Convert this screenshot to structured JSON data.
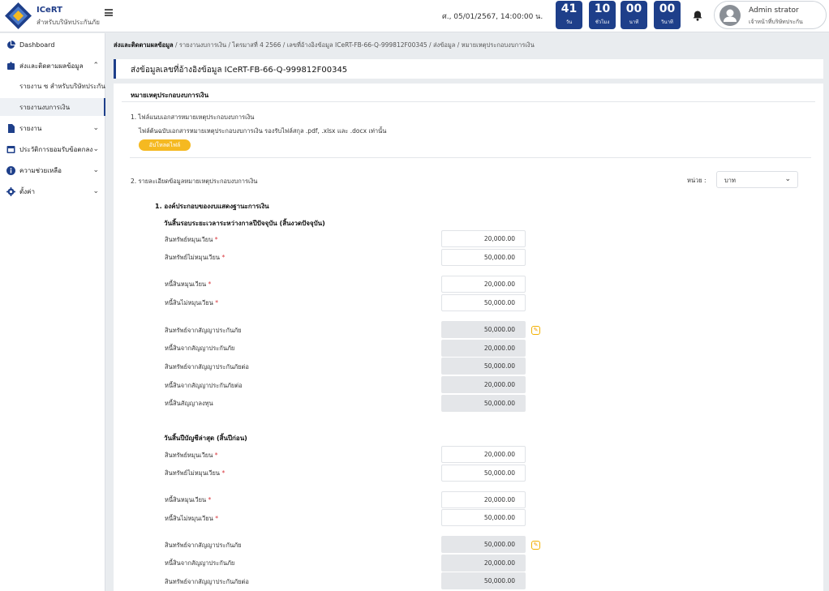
{
  "header": {
    "brand_name": "ICeRT",
    "brand_sub": "สำหรับบริษัทประกันภัย",
    "datetime": "ศ., 05/01/2567, 14:00:00 น.",
    "countdown": [
      {
        "value": "41",
        "label": "วัน"
      },
      {
        "value": "10",
        "label": "ชั่วโมง"
      },
      {
        "value": "00",
        "label": "นาที"
      },
      {
        "value": "00",
        "label": "วินาที"
      }
    ],
    "user_name": "Admin strator",
    "user_role": "เจ้าหน้าที่บริษัทประกัน"
  },
  "sidebar": {
    "items": [
      {
        "label": "Dashboard",
        "chevron": ""
      },
      {
        "label": "ส่งและติดตามผลข้อมูล",
        "chevron": "⌃"
      },
      {
        "label": "รายงาน",
        "chevron": "⌄"
      },
      {
        "label": "ประวัติการยอมรับข้อตกลง",
        "chevron": "⌄"
      },
      {
        "label": "ความช่วยเหลือ",
        "chevron": "⌄"
      },
      {
        "label": "ตั้งค่า",
        "chevron": "⌄"
      }
    ],
    "sub_items": [
      {
        "label": "รายงาน ซ สำหรับบริษัทประกัน"
      },
      {
        "label": "รายงานงบการเงิน"
      }
    ]
  },
  "breadcrumb": {
    "root": "ส่งและติดตามผลข้อมูล",
    "rest": " / รายงานงบการเงิน / ไตรมาสที่ 4  2566 / เลขที่อ้างอิงข้อมูล ICeRT-FB-66-Q-999812F00345 / ส่งข้อมูล / หมายเหตุประกอบงบการเงิน"
  },
  "page_title": "ส่งข้อมูลเลขที่อ้างอิงข้อมูล ICeRT-FB-66-Q-999812F00345",
  "section": {
    "title": "หมายเหตุประกอบงบการเงิน",
    "attach_title": "1. ไฟล์แนบเอกสารหมายเหตุประกอบงบการเงิน",
    "attach_hint": "ไฟล์ต้นฉบับเอกสารหมายเหตุประกอบงบการเงิน รองรับไฟล์สกุล .pdf, .xlsx และ .docx  เท่านั้น",
    "upload_label": "อัปโหลดไฟล์",
    "detail_title": "2. รายละเอียดข้อมูลหมายเหตุประกอบงบการเงิน",
    "unit_label": "หน่วย :",
    "unit_value": "บาท",
    "group_title": "1.  องค์ประกอบของงบแสดงฐานะการเงิน",
    "current": {
      "heading": "วันสิ้นรอบระยะเวลาระหว่างกาลปีปัจจุบัน (สิ้นงวดปัจจุบัน)",
      "rows": [
        {
          "label": "สินทรัพย์หมุนเวียน",
          "value": "20,000.00"
        },
        {
          "label": "สินทรัพย์ไม่หมุนเวียน",
          "value": "50,000.00"
        },
        {
          "label": "หนี้สินหมุนเวียน",
          "value": "20,000.00"
        },
        {
          "label": "หนี้สินไม่หมุนเวียน",
          "value": "50,000.00"
        },
        {
          "label": "สินทรัพย์จากสัญญาประกันภัย",
          "value": "50,000.00"
        },
        {
          "label": "หนี้สินจากสัญญาประกันภัย",
          "value": "20,000.00"
        },
        {
          "label": "สินทรัพย์จากสัญญาประกันภัยต่อ",
          "value": "50,000.00"
        },
        {
          "label": "หนี้สินจากสัญญาประกันภัยต่อ",
          "value": "20,000.00"
        },
        {
          "label": "หนี้สินสัญญาลงทุน",
          "value": "50,000.00"
        }
      ]
    },
    "previous": {
      "heading": "วันสิ้นปีบัญชีล่าสุด (สิ้นปีก่อน)",
      "rows": [
        {
          "label": "สินทรัพย์หมุนเวียน",
          "value": "20,000.00"
        },
        {
          "label": "สินทรัพย์ไม่หมุนเวียน",
          "value": "50,000.00"
        },
        {
          "label": "หนี้สินหมุนเวียน",
          "value": "20,000.00"
        },
        {
          "label": "หนี้สินไม่หมุนเวียน",
          "value": "50,000.00"
        },
        {
          "label": "สินทรัพย์จากสัญญาประกันภัย",
          "value": "50,000.00"
        },
        {
          "label": "หนี้สินจากสัญญาประกันภัย",
          "value": "20,000.00"
        },
        {
          "label": "สินทรัพย์จากสัญญาประกันภัยต่อ",
          "value": "50,000.00"
        }
      ]
    }
  },
  "colors": {
    "primary": "#1e3f8a",
    "accent": "#f5b921",
    "required": "#d9343a"
  }
}
